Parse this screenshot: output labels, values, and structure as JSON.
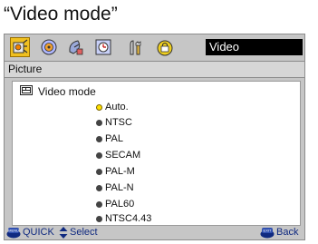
{
  "caption": "“Video mode”",
  "iconbar": {
    "icons": [
      "picture-icon",
      "sound-icon",
      "satellite-dish-icon",
      "timer-icon",
      "settings-icon",
      "lock-icon"
    ],
    "selected_icon": "picture-icon",
    "title": "Video"
  },
  "section": {
    "header": "Picture"
  },
  "menu": {
    "title": "Video mode",
    "options": [
      {
        "label": "Auto.",
        "selected": true
      },
      {
        "label": "NTSC",
        "selected": false
      },
      {
        "label": "PAL",
        "selected": false
      },
      {
        "label": "SECAM",
        "selected": false
      },
      {
        "label": "PAL-M",
        "selected": false
      },
      {
        "label": "PAL-N",
        "selected": false
      },
      {
        "label": "PAL60",
        "selected": false
      },
      {
        "label": "NTSC4.43",
        "selected": false
      }
    ]
  },
  "footer": {
    "quick_label": "QUICK",
    "quick_key_text": "MENU",
    "select_label": "Select",
    "back_label": "Back",
    "back_key_text": "EXIT"
  },
  "colors": {
    "selected_radio": "#ffe000",
    "unselected_radio": "#444444",
    "selected_tab": "#f0c020",
    "footer_text": "#102a80"
  }
}
